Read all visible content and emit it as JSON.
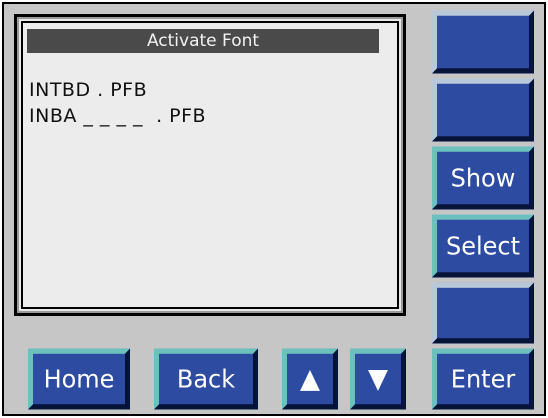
{
  "screen": {
    "title": "Activate Font",
    "lines": [
      "INTBD . PFB",
      "INBA _ _ _ _  . PFB"
    ]
  },
  "side_buttons": [
    "",
    "",
    "Show",
    "Select",
    "",
    "Enter"
  ],
  "bottom_buttons": {
    "home": "Home",
    "back": "Back",
    "up": "▲",
    "down": "▼"
  },
  "colors": {
    "button_face": "#2d4ba0",
    "panel": "#c6c6c6",
    "screen_bg": "#ececec",
    "title_bar": "#4a4a4a"
  }
}
